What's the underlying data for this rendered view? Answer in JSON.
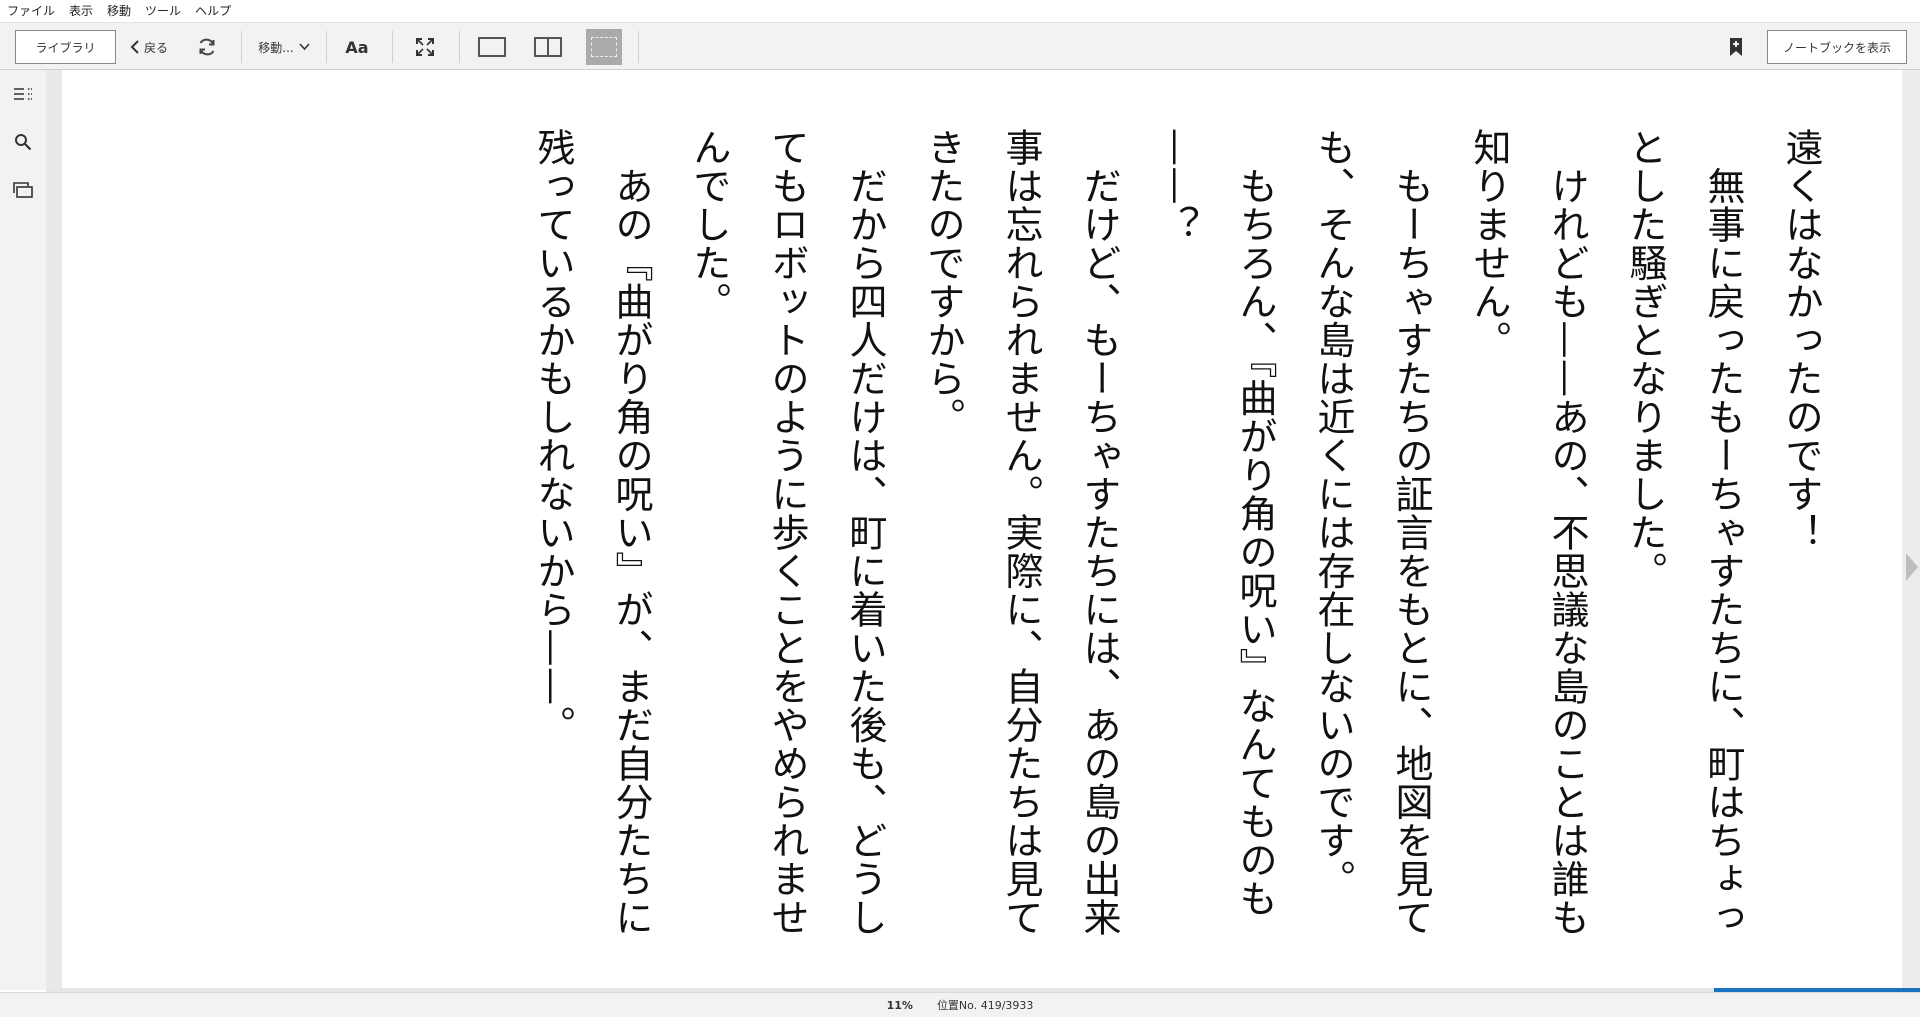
{
  "menu": [
    "ファイル",
    "表示",
    "移動",
    "ツール",
    "ヘルプ"
  ],
  "toolbar": {
    "library_label": "ライブラリ",
    "back_label": "戻る",
    "goto_label": "移動...",
    "font_label": "Aa",
    "notebook_label": "ノートブックを表示"
  },
  "text": {
    "paragraphs": [
      "遠くはなかったのです！",
      "　無事に戻ったもーちゃすたちに、町はちょっとした騒ぎとなりました。",
      "　けれども——あの、不思議な島のことは誰も知りません。",
      "　もーちゃすたちの証言をもとに、地図を見ても、そんな島は近くには存在しないのです。",
      "　もちろん、『曲がり角の呪い』なんてものも——？",
      "　だけど、もーちゃすたちには、あの島の出来事は忘れられません。実際に、自分たちは見てきたのですから。",
      "　だから四人だけは、町に着いた後も、どうしてもロボットのように歩くことをやめられませんでした。",
      "　あの『曲がり角の呪い』が、まだ自分たちに残っているかもしれないから——。"
    ]
  },
  "status": {
    "percent": "11%",
    "location": "位置No. 419/3933",
    "progress": 0.11
  }
}
